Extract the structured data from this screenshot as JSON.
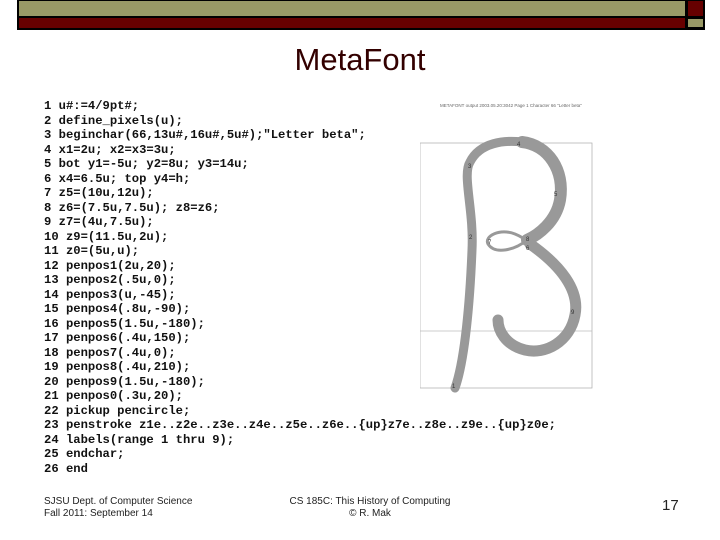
{
  "slide": {
    "title": "MetaFont",
    "code_lines": [
      "1 u#:=4/9pt#;",
      "2 define_pixels(u);",
      "3 beginchar(66,13u#,16u#,5u#);\"Letter beta\";",
      "4 x1=2u; x2=x3=3u;",
      "5 bot y1=-5u; y2=8u; y3=14u;",
      "6 x4=6.5u; top y4=h;",
      "7 z5=(10u,12u);",
      "8 z6=(7.5u,7.5u); z8=z6;",
      "9 z7=(4u,7.5u);",
      "10 z9=(11.5u,2u);",
      "11 z0=(5u,u);",
      "12 penpos1(2u,20);",
      "13 penpos2(.5u,0);",
      "14 penpos3(u,-45);",
      "15 penpos4(.8u,-90);",
      "16 penpos5(1.5u,-180);",
      "17 penpos6(.4u,150);",
      "18 penpos7(.4u,0);",
      "19 penpos8(.4u,210);",
      "20 penpos9(1.5u,-180);",
      "21 penpos0(.3u,20);",
      "22 pickup pencircle;",
      "23 penstroke z1e..z2e..z3e..z4e..z5e..z6e..{up}z7e..z8e..z9e..{up}z0e;",
      "24 labels(range 1 thru 9);",
      "25 endchar;",
      "26 end"
    ],
    "figure": {
      "caption": "METAFONT output 2003.05.20:3042 Page 1 Character 66 \"Letter beta\"",
      "point_labels": [
        "1",
        "2",
        "3",
        "4",
        "5",
        "6",
        "7",
        "8",
        "9"
      ]
    }
  },
  "footer": {
    "dept": "SJSU Dept. of Computer Science",
    "date": "Fall 2011: September 14",
    "course": "CS 185C: This History of Computing",
    "author": "© R. Mak",
    "page": "17"
  },
  "colors": {
    "tan": "#999966",
    "maroon": "#660000",
    "title": "#330000"
  }
}
